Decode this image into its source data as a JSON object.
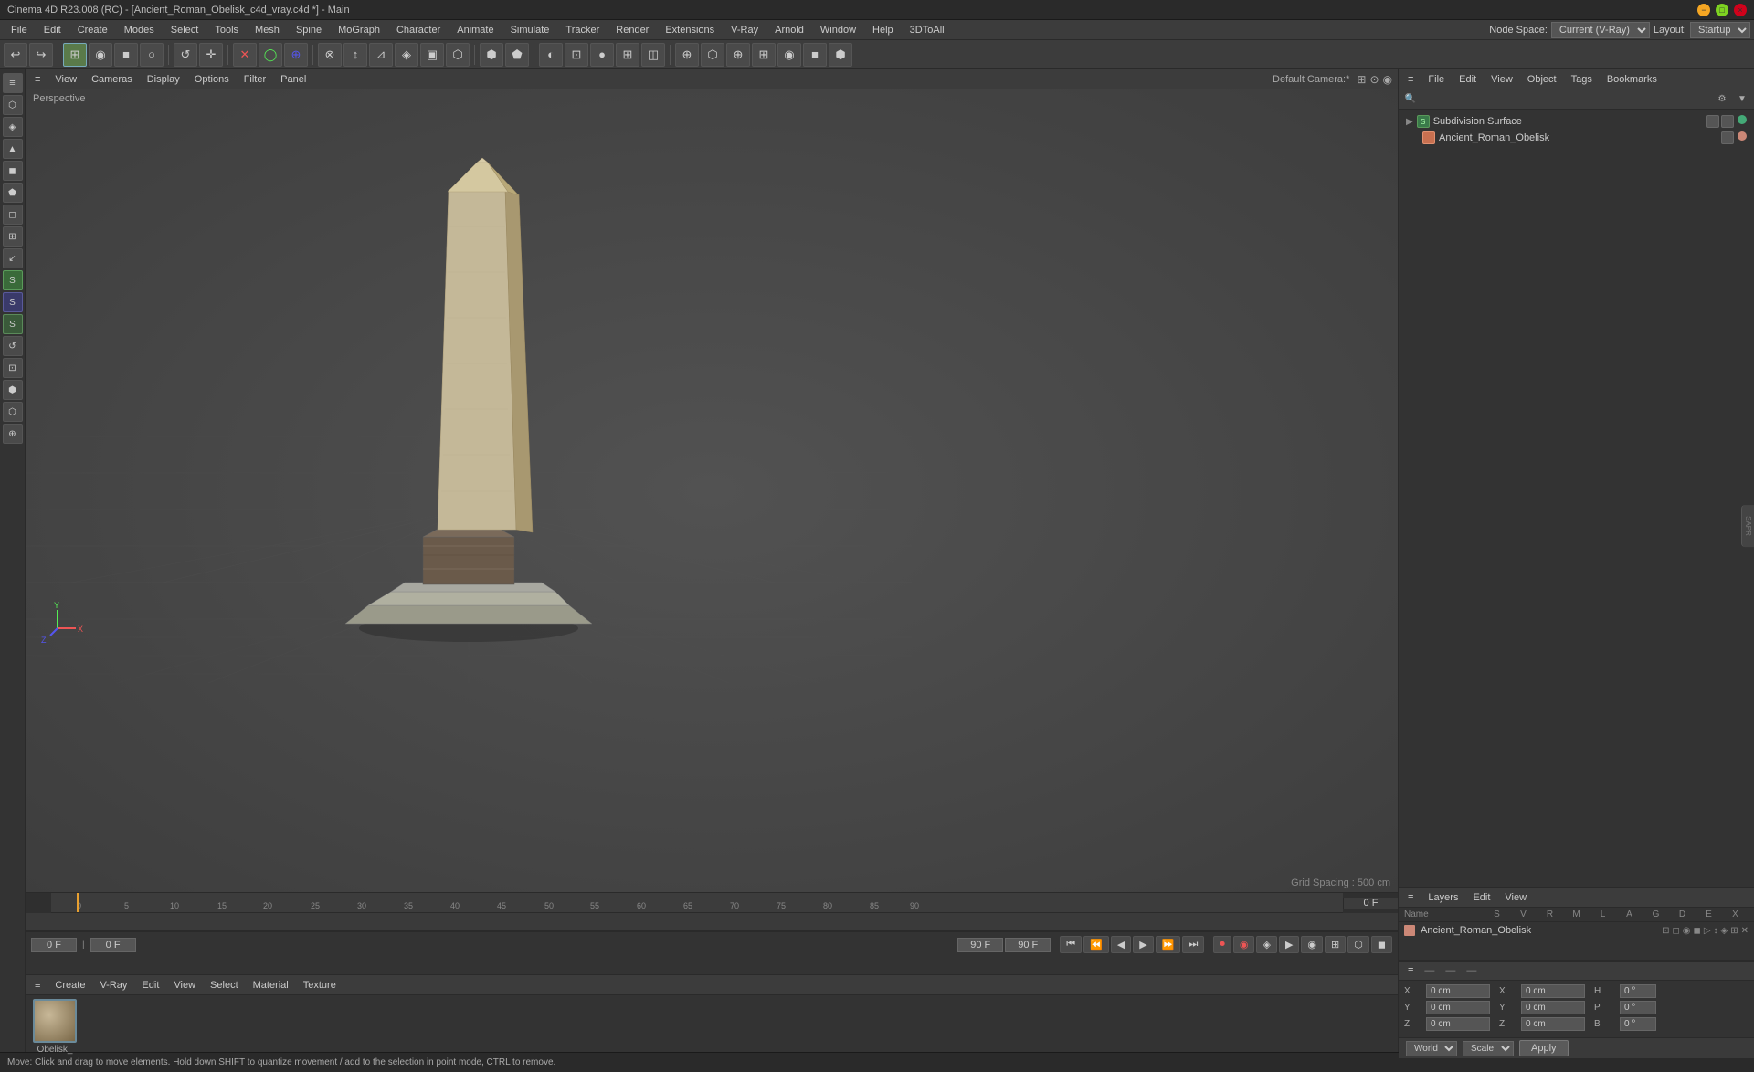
{
  "title_bar": {
    "title": "Cinema 4D R23.008 (RC) - [Ancient_Roman_Obelisk_c4d_vray.c4d *] - Main",
    "minimize_label": "−",
    "maximize_label": "□",
    "close_label": "×"
  },
  "menu_bar": {
    "items": [
      "File",
      "Edit",
      "Create",
      "Modes",
      "Select",
      "Tools",
      "Mesh",
      "Spine",
      "MoGraph",
      "Character",
      "Animate",
      "Simulate",
      "Tracker",
      "Render",
      "Extensions",
      "V-Ray",
      "Arnold",
      "Window",
      "Help",
      "3DToAll"
    ],
    "node_space_label": "Node Space:",
    "node_space_value": "Current (V-Ray)",
    "layout_label": "Layout:",
    "layout_value": "Startup"
  },
  "toolbar": {
    "undo": "↩",
    "redo": "↪",
    "tools": [
      "⊞",
      "◉",
      "■",
      "○",
      "↺",
      "✛",
      "✕",
      "◯",
      "⊕",
      "⊗",
      "↕",
      "⊿",
      "◈",
      "▣",
      "⬡",
      "⬢",
      "⬟",
      "◐",
      "⊡",
      "●",
      "⊞",
      "◫",
      "⊕",
      "⬡",
      "⊕",
      "⊞",
      "◉",
      "■",
      "⬢"
    ]
  },
  "viewport": {
    "perspective": "Perspective",
    "camera": "Default Camera:*",
    "header_items": [
      "≡",
      "View",
      "Cameras",
      "Display",
      "Options",
      "Filter",
      "Panel"
    ],
    "grid_spacing": "Grid Spacing : 500 cm"
  },
  "object_manager": {
    "header_items": [
      "≡",
      "File",
      "Edit",
      "View",
      "Object",
      "Tags",
      "Bookmarks"
    ],
    "objects": [
      {
        "name": "Subdivision Surface",
        "icon": "green",
        "level": 0
      },
      {
        "name": "Ancient_Roman_Obelisk",
        "icon": "pink",
        "level": 1
      }
    ]
  },
  "layers": {
    "header_items": [
      "≡",
      "Layers",
      "Edit",
      "View"
    ],
    "columns": [
      "Name",
      "S",
      "V",
      "R",
      "M",
      "L",
      "A",
      "G",
      "D",
      "E",
      "X"
    ],
    "items": [
      {
        "name": "Ancient_Roman_Obelisk",
        "color": "#c87050"
      }
    ]
  },
  "timeline": {
    "frame_start": "0",
    "frame_end": "0 F",
    "current_frame_left": "0 F",
    "current_frame_right": "0 F",
    "preview_start": "90 F",
    "preview_end": "90 F",
    "ruler_marks": [
      "0",
      "5",
      "10",
      "15",
      "20",
      "25",
      "30",
      "35",
      "40",
      "45",
      "50",
      "55",
      "60",
      "65",
      "70",
      "75",
      "80",
      "85",
      "90"
    ],
    "playback_buttons": [
      "⏮",
      "⏪",
      "◀",
      "▶",
      "▶▶",
      "⏩",
      "⏭"
    ]
  },
  "material_bar": {
    "header_items": [
      "≡",
      "Create",
      "V-Ray",
      "Edit",
      "View",
      "Select",
      "Material",
      "Texture"
    ],
    "material_name": "Obelisk_"
  },
  "attributes": {
    "header_items": [
      "≡",
      "—",
      "—",
      "—"
    ],
    "x_label": "X",
    "y_label": "Y",
    "z_label": "Z",
    "x_value": "0 cm",
    "y_value": "0 cm",
    "z_value": "0 cm",
    "x2_label": "X",
    "y2_label": "Y",
    "z2_label": "Z",
    "x2_value": "0 cm",
    "y2_value": "0 cm",
    "z2_value": "0 cm",
    "h_label": "H",
    "p_label": "P",
    "b_label": "B",
    "h_value": "0 °",
    "p_value": "0 °",
    "b_value": "0 °",
    "world_label": "World",
    "scale_label": "Scale",
    "apply_label": "Apply"
  },
  "status_bar": {
    "text": "Move: Click and drag to move elements. Hold down SHIFT to quantize movement / add to the selection in point mode, CTRL to remove."
  }
}
